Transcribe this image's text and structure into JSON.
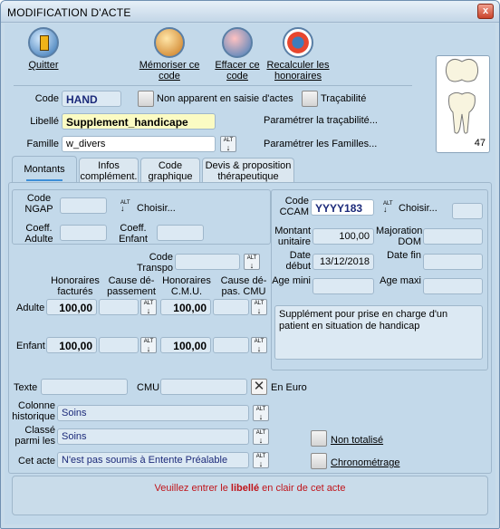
{
  "window": {
    "title": "MODIFICATION D'ACTE",
    "close": "x"
  },
  "toolbar": {
    "quit": "Quitter",
    "memorize": "Mémoriser ce code",
    "erase": "Effacer ce code",
    "recalc": "Recalculer les honoraires"
  },
  "form": {
    "code_label": "Code",
    "code_value": "HAND",
    "non_apparent_label": "Non apparent en saisie d'actes",
    "tracabilite_label": "Traçabilité",
    "libelle_label": "Libellé",
    "libelle_value": "Supplement_handicape",
    "param_tracabilite": "Paramétrer la traçabilité...",
    "famille_label": "Famille",
    "famille_value": "w_divers",
    "param_familles": "Paramétrer les Familles...",
    "tooth_number": "47"
  },
  "tabs": [
    "Montants",
    "Infos complément.",
    "Code graphique",
    "Devis & proposition thérapeutique"
  ],
  "montants": {
    "code_ngap_label": "Code NGAP",
    "choisir": "Choisir...",
    "coeff_adulte": "Coeff. Adulte",
    "coeff_enfant": "Coeff. Enfant",
    "code_transpo": "Code Transpo",
    "col_hon_fact": "Honoraires facturés",
    "col_cause_dep": "Cause dé-passement",
    "col_hon_cmu": "Honoraires C.M.U.",
    "col_cause_cmu": "Cause dé-pas. CMU",
    "adulte_label": "Adulte",
    "adulte_hon": "100,00",
    "adulte_cmu": "100,00",
    "enfant_label": "Enfant",
    "enfant_hon": "100,00",
    "enfant_cmu": "100,00",
    "ccam_label": "Code CCAM",
    "ccam_value": "YYYY183",
    "ccam_choisir": "Choisir...",
    "montant_label": "Montant unitaire",
    "montant_value": "100,00",
    "majoration_label": "Majoration DOM",
    "date_debut_label": "Date début",
    "date_debut_value": "13/12/2018",
    "date_fin_label": "Date fin",
    "age_mini_label": "Age mini",
    "age_maxi_label": "Age maxi",
    "description": "Supplément pour prise en charge d'un patient en situation de handicap",
    "texte_label": "Texte",
    "cmu_label": "CMU",
    "en_euro": "En Euro",
    "colonne_label": "Colonne historique",
    "colonne_value": "Soins",
    "classe_label": "Classé parmi les",
    "classe_value": "Soins",
    "cet_acte_label": "Cet acte",
    "cet_acte_value": "N'est pas soumis à Entente Préalable",
    "non_totalise": "Non totalisé",
    "chronometrage": "Chronométrage"
  },
  "status": {
    "msg_pre": "Veuillez entrer le ",
    "msg_mid": "libellé",
    "msg_post": " en clair de cet acte"
  },
  "alt": {
    "top": "ALT"
  }
}
